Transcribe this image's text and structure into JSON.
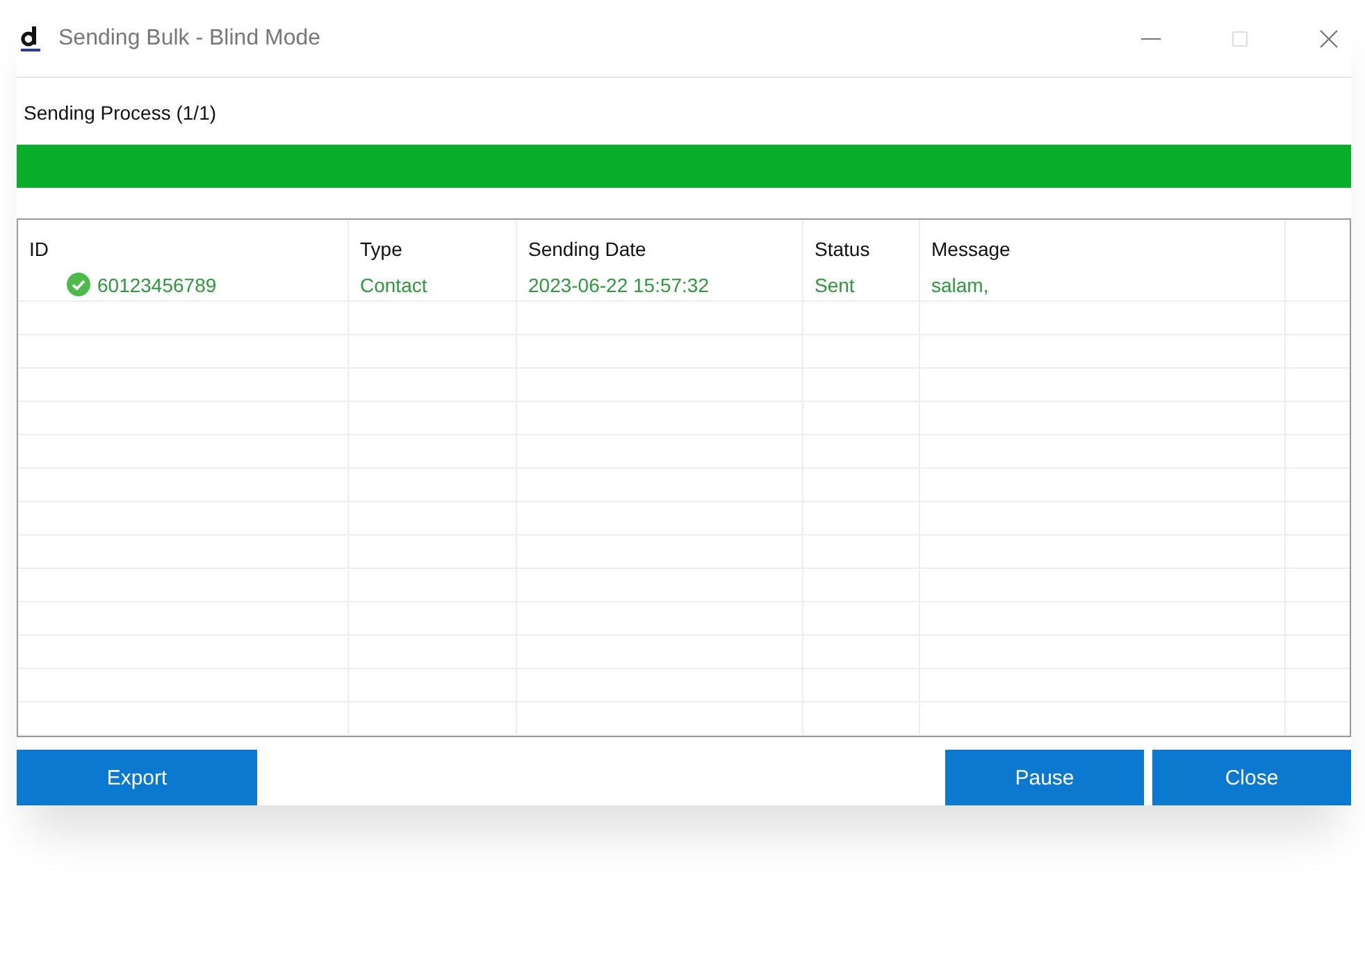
{
  "window": {
    "title": "Sending Bulk - Blind Mode",
    "maximize_disabled": true
  },
  "progress": {
    "label": "Sending Process (1/1)",
    "level": 1
  },
  "table": {
    "columns": [
      "ID",
      "Type",
      "Sending Date",
      "Status",
      "Message"
    ],
    "rows": [
      {
        "id": "60123456789",
        "type": "Contact",
        "date": "2023-06-22 15:57:32",
        "status": "Sent",
        "message": "salam,",
        "success": true
      }
    ]
  },
  "buttons": {
    "left": [
      "Export"
    ],
    "right": [
      "Pause",
      "Close"
    ]
  }
}
